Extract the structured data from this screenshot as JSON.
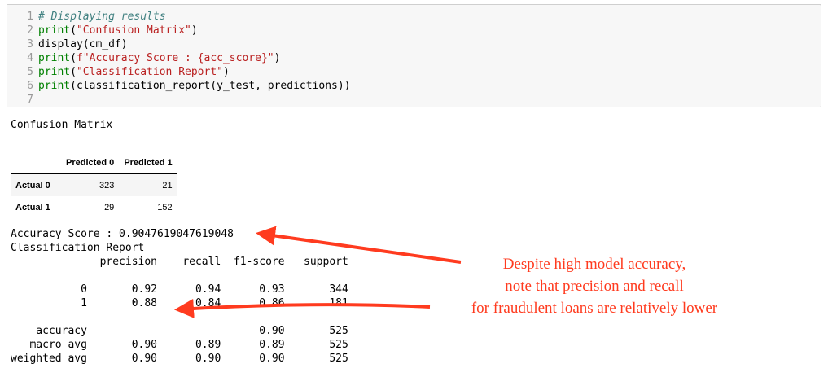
{
  "code_cell": {
    "lines": [
      {
        "num": "1",
        "comment": "# Displaying results"
      },
      {
        "num": "2",
        "fn": "print",
        "open": "(",
        "str": "\"Confusion Matrix\"",
        "close": ")"
      },
      {
        "num": "3",
        "plain": "display(cm_df)"
      },
      {
        "num": "4",
        "fn": "print",
        "open": "(",
        "str": "f\"Accuracy Score : {acc_score}\"",
        "close": ")"
      },
      {
        "num": "5",
        "fn": "print",
        "open": "(",
        "str": "\"Classification Report\"",
        "close": ")"
      },
      {
        "num": "6",
        "fn": "print",
        "rest": "(classification_report(y_test, predictions))"
      },
      {
        "num": "7"
      }
    ]
  },
  "output": {
    "confusion_title": "Confusion Matrix",
    "matrix": {
      "columns": [
        "Predicted 0",
        "Predicted 1"
      ],
      "rows": [
        {
          "label": "Actual 0",
          "values": [
            "323",
            "21"
          ]
        },
        {
          "label": "Actual 1",
          "values": [
            "29",
            "152"
          ]
        }
      ]
    },
    "accuracy_line": "Accuracy Score : 0.9047619047619048",
    "report_title": "Classification Report",
    "report_text": "              precision    recall  f1-score   support\n\n           0       0.92      0.94      0.93       344\n           1       0.88      0.84      0.86       181\n\n    accuracy                           0.90       525\n   macro avg       0.90      0.89      0.89       525\nweighted avg       0.90      0.90      0.90       525"
  },
  "annotation": {
    "lines": [
      "Despite high model accuracy,",
      "note that precision and recall",
      "for fraudulent loans are relatively lower"
    ],
    "color": "#ff3b1f"
  }
}
